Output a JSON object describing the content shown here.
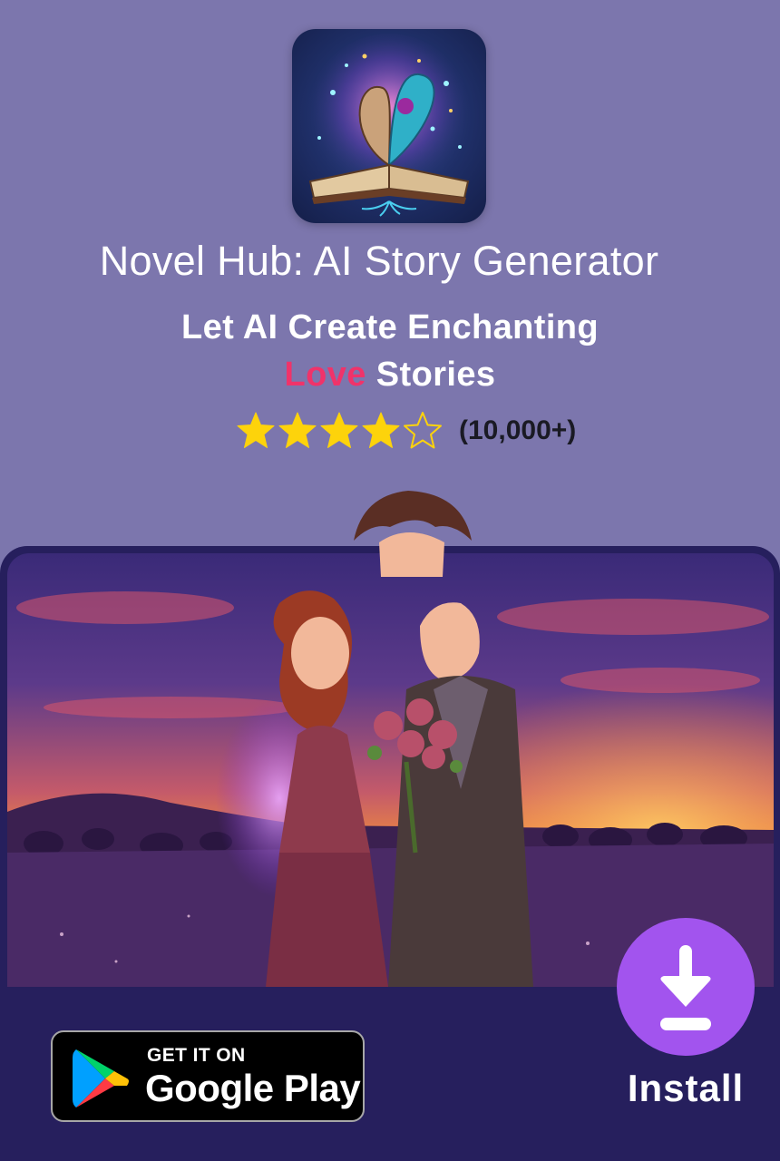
{
  "app": {
    "title": "Novel Hub: AI Story Generator",
    "icon_name": "open-book-icon"
  },
  "tagline": {
    "line1": "Let AI Create Enchanting",
    "highlight": "Love",
    "line2_rest": " Stories"
  },
  "rating": {
    "value": 4,
    "max": 5,
    "count_text": "(10,000+)"
  },
  "hero": {
    "image_name": "couple-sunset-illustration"
  },
  "store_badge": {
    "small_text": "GET IT ON",
    "big_text": "Google Play",
    "icon_name": "google-play-icon"
  },
  "install": {
    "label": "Install",
    "icon_name": "download-icon"
  },
  "colors": {
    "background": "#7c76ad",
    "panel": "#261f5d",
    "accent_love": "#f0336a",
    "star": "#fdd30b",
    "install_button": "#a254ee"
  }
}
